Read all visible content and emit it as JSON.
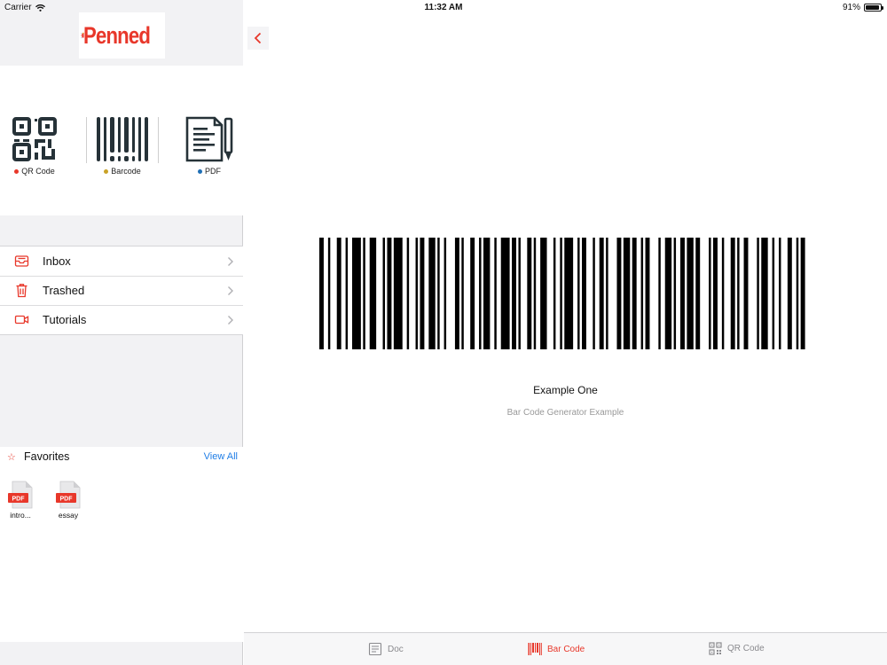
{
  "status_bar": {
    "carrier": "Carrier",
    "time": "11:32 AM",
    "battery": "91%",
    "battery_level": 0.91
  },
  "app": {
    "name": "Penned",
    "accent_color": "#e8372a",
    "link_color": "#1f7de6"
  },
  "scan_options": [
    {
      "label": "QR Code",
      "icon": "qr-code-icon",
      "dot_color": "#e8372a"
    },
    {
      "label": "Barcode",
      "icon": "barcode-icon",
      "dot_color": "#c9a227"
    },
    {
      "label": "PDF",
      "icon": "pdf-document-icon",
      "dot_color": "#1f6fb5"
    }
  ],
  "menu": [
    {
      "label": "Inbox",
      "icon": "inbox-icon"
    },
    {
      "label": "Trashed",
      "icon": "trash-icon"
    },
    {
      "label": "Tutorials",
      "icon": "video-camera-icon"
    }
  ],
  "favorites": {
    "title": "Favorites",
    "view_all": "View All",
    "items": [
      {
        "name": "intro...",
        "type_badge": "PDF"
      },
      {
        "name": "essay",
        "type_badge": "PDF"
      }
    ]
  },
  "detail": {
    "title": "Example One",
    "subtitle": "Bar Code Generator Example"
  },
  "tabs": [
    {
      "label": "Doc",
      "icon": "document-icon",
      "active": false
    },
    {
      "label": "Bar Code",
      "icon": "barcode-icon",
      "active": true
    },
    {
      "label": "QR Code",
      "icon": "qr-code-icon",
      "active": false
    }
  ]
}
